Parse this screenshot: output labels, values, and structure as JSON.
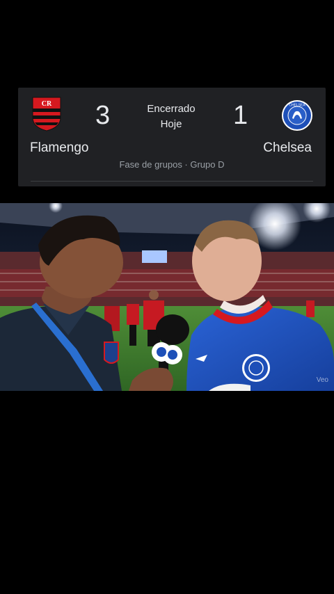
{
  "match": {
    "home_team": "Flamengo",
    "away_team": "Chelsea",
    "home_score": "3",
    "away_score": "1",
    "status_line1": "Encerrado",
    "status_line2": "Hoje",
    "stage": "Fase de grupos · Grupo D",
    "home_logo": "flamengo-crest-icon",
    "away_logo": "chelsea-crest-icon",
    "away_logo_text": "CHELSEA"
  },
  "video": {
    "watermark": "Veo",
    "colors": {
      "card_bg": "#202124",
      "chelsea_blue": "#1d4fb8",
      "flamengo_red": "#d6191f",
      "pitch_green": "#3f7d2f"
    }
  }
}
